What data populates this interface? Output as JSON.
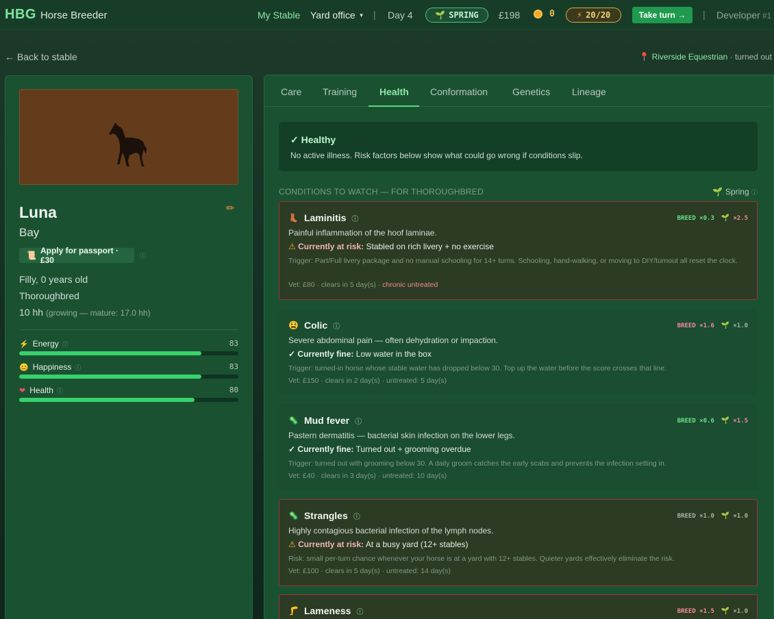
{
  "topbar": {
    "logo": "HBG",
    "app_name": "Horse Breeder",
    "nav_my_stable": "My Stable",
    "nav_yard_office": "Yard office",
    "day": "Day 4",
    "season": "SPRING",
    "money": "£198",
    "coins": "0",
    "energy": "20/20",
    "take_turn": "Take turn →",
    "developer": "Developer",
    "developer_num": "#1"
  },
  "subheader": {
    "back": "← Back to stable",
    "location_name": "Riverside Equestrian",
    "location_status": "· turned out"
  },
  "horse": {
    "name": "Luna",
    "coat": "Bay",
    "passport_button": "Apply for passport · £30",
    "age": "Filly, 0 years old",
    "breed": "Thoroughbred",
    "height": "10 hh",
    "height_note": "(growing — mature: 17.0 hh)",
    "stats": [
      {
        "label": "Energy",
        "value": "83",
        "fraction": 0.83,
        "icon": "lightning-icon"
      },
      {
        "label": "Happiness",
        "value": "83",
        "fraction": 0.83,
        "icon": "smiley-icon"
      },
      {
        "label": "Health",
        "value": "80",
        "fraction": 0.8,
        "icon": "heart-icon"
      }
    ]
  },
  "tabs": [
    "Care",
    "Training",
    "Health",
    "Conformation",
    "Genetics",
    "Lineage"
  ],
  "active_tab": "Health",
  "health": {
    "status_title": "✓ Healthy",
    "status_desc": "No active illness. Risk factors below show what could go wrong if conditions slip.",
    "section_title": "CONDITIONS TO WATCH — FOR THOROUGHBRED",
    "season_label": "Spring",
    "conditions": [
      {
        "name": "Laminitis",
        "icon": "hoof-icon",
        "breed_mod": "BREED ×0.3",
        "season_mod": "×2.5",
        "desc": "Painful inflammation of the hoof laminae.",
        "status_prefix": "Currently at risk:",
        "status_text": "Stabled on rich livery + no exercise",
        "trigger": "Trigger: Part/Full livery package and no manual schooling for 14+ turns. Schooling, hand-walking, or moving to DIY/turnout all reset the clock.",
        "vet": "Vet: £80 · clears in 5 day(s) ·",
        "vet_extra": "chronic untreated"
      },
      {
        "name": "Colic",
        "icon": "pain-face-icon",
        "breed_mod": "BREED ×1.6",
        "season_mod": "×1.0",
        "desc": "Severe abdominal pain — often dehydration or impaction.",
        "status_prefix": "Currently fine:",
        "status_text": "Low water in the box",
        "trigger": "Trigger: turned-in horse whose stable water has dropped below 30. Top up the water before the score crosses that line.",
        "vet": "Vet: £150 · clears in 2 day(s) · untreated: 5 day(s)"
      },
      {
        "name": "Mud fever",
        "icon": "microbe-icon",
        "breed_mod": "BREED ×0.6",
        "season_mod": "×1.5",
        "desc": "Pastern dermatitis — bacterial skin infection on the lower legs.",
        "status_prefix": "Currently fine:",
        "status_text": "Turned out + grooming overdue",
        "trigger": "Trigger: turned out with grooming below 30. A daily groom catches the early scabs and prevents the infection setting in.",
        "vet": "Vet: £40 · clears in 3 day(s) · untreated: 10 day(s)"
      },
      {
        "name": "Strangles",
        "icon": "microbe-icon",
        "breed_mod": "BREED ×1.0",
        "season_mod": "×1.0",
        "desc": "Highly contagious bacterial infection of the lymph nodes.",
        "status_prefix": "Currently at risk:",
        "status_text": "At a busy yard (12+ stables)",
        "trigger": "Risk: small per-turn chance whenever your horse is at a yard with 12+ stables. Quieter yards effectively eliminate the risk.",
        "vet": "Vet: £100 · clears in 5 day(s) · untreated: 14 day(s)"
      },
      {
        "name": "Lameness",
        "icon": "leg-icon",
        "breed_mod": "BREED ×1.5",
        "season_mod": "×1.0"
      }
    ]
  },
  "colors": {
    "accent": "#8ee6a8",
    "panel": "#1a5231",
    "risk_border": "#9a3535",
    "bar_fill": "#38d26c",
    "take_turn_bg": "#1f9a4e"
  }
}
